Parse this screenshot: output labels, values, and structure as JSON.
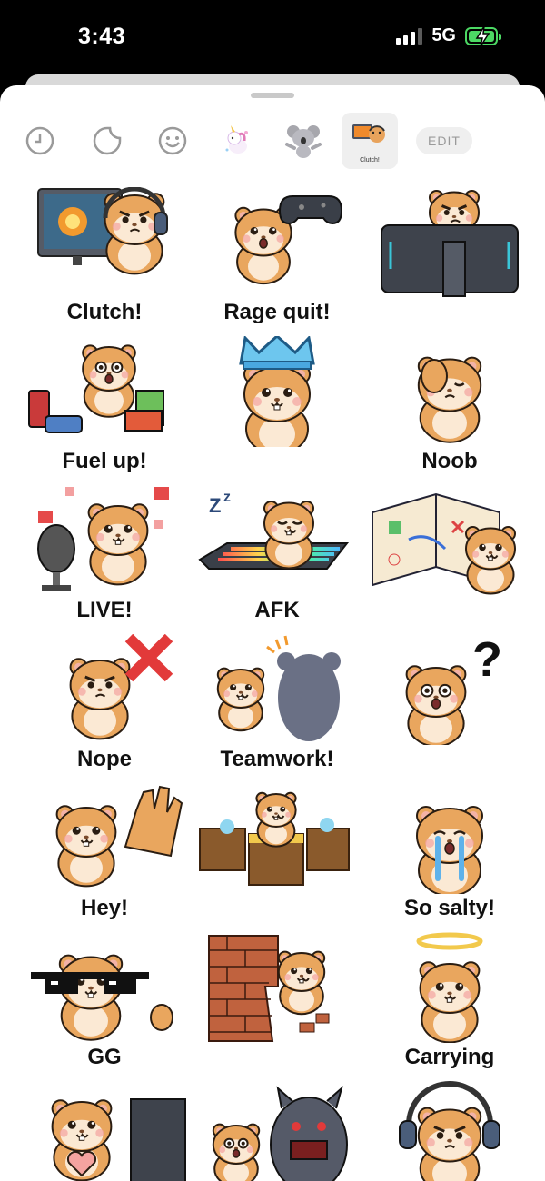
{
  "status": {
    "time": "3:43",
    "network": "5G"
  },
  "tabs": [
    {
      "icon": "recent-clock-icon"
    },
    {
      "icon": "sticker-icon"
    },
    {
      "icon": "emoji-smile-icon"
    },
    {
      "icon": "unicorn-sticker-pack-icon"
    },
    {
      "icon": "koala-sticker-pack-icon"
    },
    {
      "icon": "hamster-gamer-sticker-pack-icon",
      "label": "Clutch!"
    }
  ],
  "edit_label": "EDIT",
  "stickers": [
    {
      "caption": "Clutch!",
      "art": "hamster-gaming-at-monitor"
    },
    {
      "caption": "Rage quit!",
      "art": "hamster-throwing-controller"
    },
    {
      "caption": "",
      "art": "hamster-peeking-over-monitor"
    },
    {
      "caption": "Fuel up!",
      "art": "hamster-with-energy-drinks"
    },
    {
      "caption": "",
      "art": "hamster-wearing-pixel-crown"
    },
    {
      "caption": "Noob",
      "art": "hamster-facepalm"
    },
    {
      "caption": "LIVE!",
      "art": "hamster-streaming-with-mic"
    },
    {
      "caption": "AFK",
      "art": "hamster-sleeping-on-keyboard"
    },
    {
      "caption": "",
      "art": "hamster-reading-strategy-book"
    },
    {
      "caption": "Nope",
      "art": "hamster-refusing-with-x"
    },
    {
      "caption": "Teamwork!",
      "art": "hamster-high-five"
    },
    {
      "caption": "",
      "art": "hamster-confused-question-mark"
    },
    {
      "caption": "Hey!",
      "art": "hamster-waving"
    },
    {
      "caption": "",
      "art": "hamster-in-treasure-chest"
    },
    {
      "caption": "So salty!",
      "art": "hamster-crying"
    },
    {
      "caption": "GG",
      "art": "hamster-with-pixel-sunglasses"
    },
    {
      "caption": "",
      "art": "hamster-breaking-brick-wall"
    },
    {
      "caption": "Carrying",
      "art": "hamster-with-halo"
    },
    {
      "caption": "",
      "art": "hamster-heart-hands-monitor"
    },
    {
      "caption": "",
      "art": "hamster-scared-by-monster"
    },
    {
      "caption": "",
      "art": "hamster-angry-with-headset"
    }
  ]
}
